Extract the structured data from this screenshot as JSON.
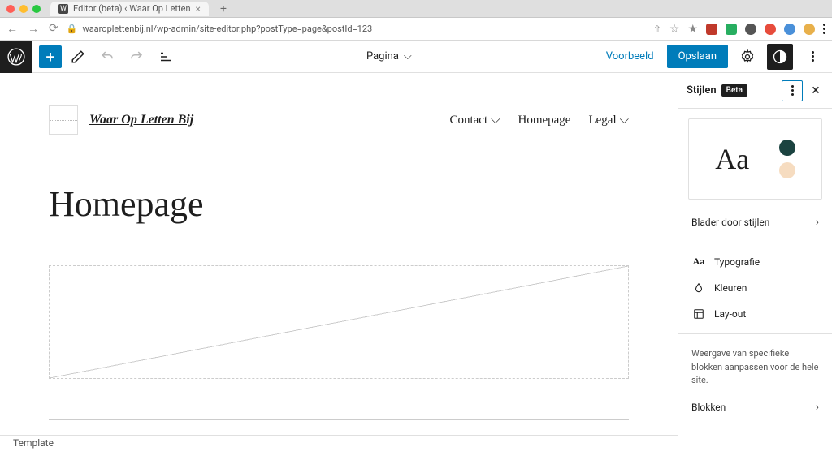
{
  "browser": {
    "tab_title": "Editor (beta) ‹ Waar Op Letten",
    "url": "waaroplettenbij.nl/wp-admin/site-editor.php?postType=page&postId=123"
  },
  "toolbar": {
    "document_type": "Pagina",
    "preview": "Voorbeeld",
    "save": "Opslaan"
  },
  "site": {
    "title": "Waar Op Letten Bij",
    "nav": [
      {
        "label": "Contact",
        "has_submenu": true
      },
      {
        "label": "Homepage",
        "has_submenu": false
      },
      {
        "label": "Legal",
        "has_submenu": true
      }
    ]
  },
  "page": {
    "title": "Homepage"
  },
  "breadcrumb": "Template",
  "styles_panel": {
    "title": "Stijlen",
    "badge": "Beta",
    "preview_text": "Aa",
    "browse": "Blader door stijlen",
    "typography": "Typografie",
    "colors": "Kleuren",
    "layout": "Lay-out",
    "blocks_hint": "Weergave van specifieke blokken aanpassen voor de hele site.",
    "blocks": "Blokken",
    "swatch_colors": {
      "dark": "#1b4340",
      "light": "#f6dcc0"
    }
  }
}
